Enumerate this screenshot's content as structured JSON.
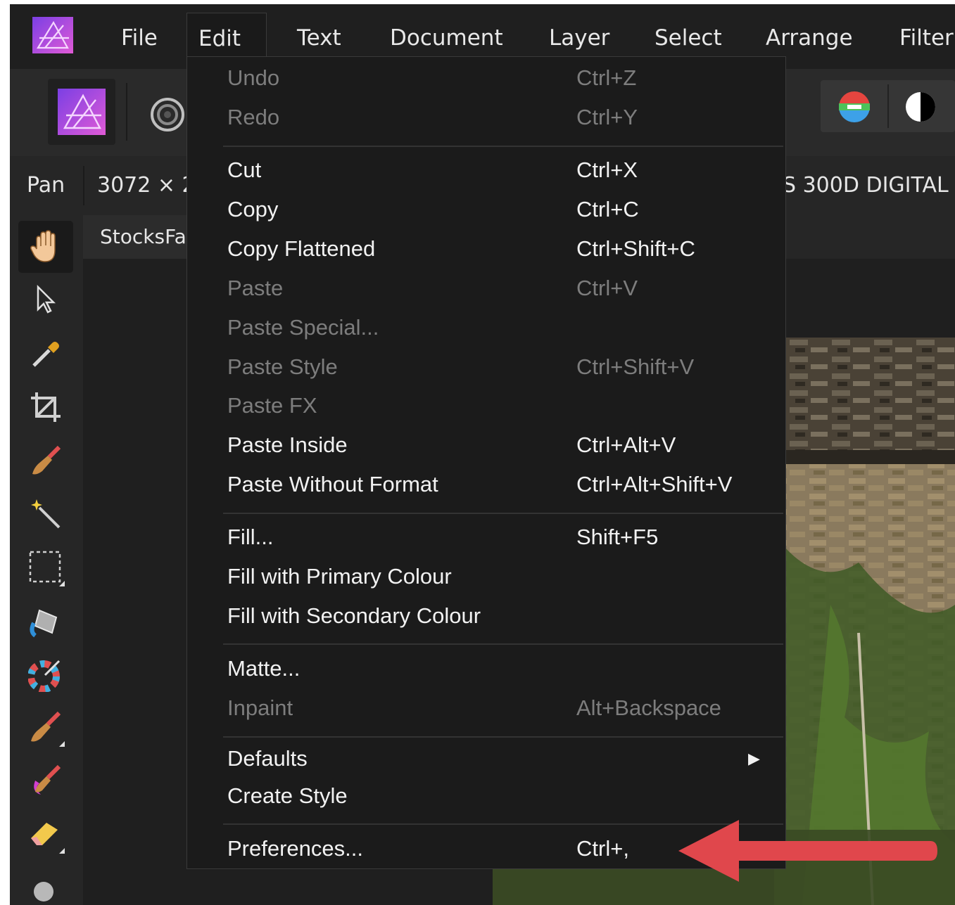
{
  "menubar": {
    "items": [
      "File",
      "Edit",
      "Text",
      "Document",
      "Layer",
      "Select",
      "Arrange",
      "Filter"
    ],
    "active": "Edit"
  },
  "context": {
    "tool": "Pan",
    "dims": "3072 × 2",
    "camera": "S 300D DIGITAL"
  },
  "document": {
    "tab": "StocksFar"
  },
  "edit_menu": {
    "items": [
      {
        "label": "Undo",
        "shortcut": "Ctrl+Z",
        "enabled": false
      },
      {
        "label": "Redo",
        "shortcut": "Ctrl+Y",
        "enabled": false
      },
      {
        "label": "Cut",
        "shortcut": "Ctrl+X",
        "enabled": true
      },
      {
        "label": "Copy",
        "shortcut": "Ctrl+C",
        "enabled": true
      },
      {
        "label": "Copy Flattened",
        "shortcut": "Ctrl+Shift+C",
        "enabled": true
      },
      {
        "label": "Paste",
        "shortcut": "Ctrl+V",
        "enabled": false
      },
      {
        "label": "Paste Special...",
        "shortcut": "",
        "enabled": false
      },
      {
        "label": "Paste Style",
        "shortcut": "Ctrl+Shift+V",
        "enabled": false
      },
      {
        "label": "Paste FX",
        "shortcut": "",
        "enabled": false
      },
      {
        "label": "Paste Inside",
        "shortcut": "Ctrl+Alt+V",
        "enabled": true
      },
      {
        "label": "Paste Without Format",
        "shortcut": "Ctrl+Alt+Shift+V",
        "enabled": true
      },
      {
        "label": "Fill...",
        "shortcut": "Shift+F5",
        "enabled": true
      },
      {
        "label": "Fill with Primary Colour",
        "shortcut": "",
        "enabled": true
      },
      {
        "label": "Fill with Secondary Colour",
        "shortcut": "",
        "enabled": true
      },
      {
        "label": "Matte...",
        "shortcut": "",
        "enabled": true
      },
      {
        "label": "Inpaint",
        "shortcut": "Alt+Backspace",
        "enabled": false
      },
      {
        "label": "Defaults",
        "shortcut": "",
        "enabled": true,
        "submenu": true
      },
      {
        "label": "Create Style",
        "shortcut": "",
        "enabled": true
      },
      {
        "label": "Preferences...",
        "shortcut": "Ctrl+,",
        "enabled": true
      }
    ]
  },
  "colors": {
    "menu_bg": "#1b1b1b",
    "text": "#f2f2f2",
    "disabled_text": "#7d7d7d",
    "annotation_arrow": "#e0474c",
    "logo_gradient": [
      "#7b3fe4",
      "#e05ad6"
    ]
  },
  "icons": {
    "tools": [
      "hand-icon",
      "pointer-icon",
      "eyedropper-icon",
      "crop-icon",
      "paint-brush-icon",
      "magic-wand-icon",
      "marquee-icon",
      "fill-bucket-icon",
      "colour-picker-icon",
      "brush-icon",
      "smudge-brush-icon",
      "eraser-icon",
      "dodge-icon"
    ]
  }
}
